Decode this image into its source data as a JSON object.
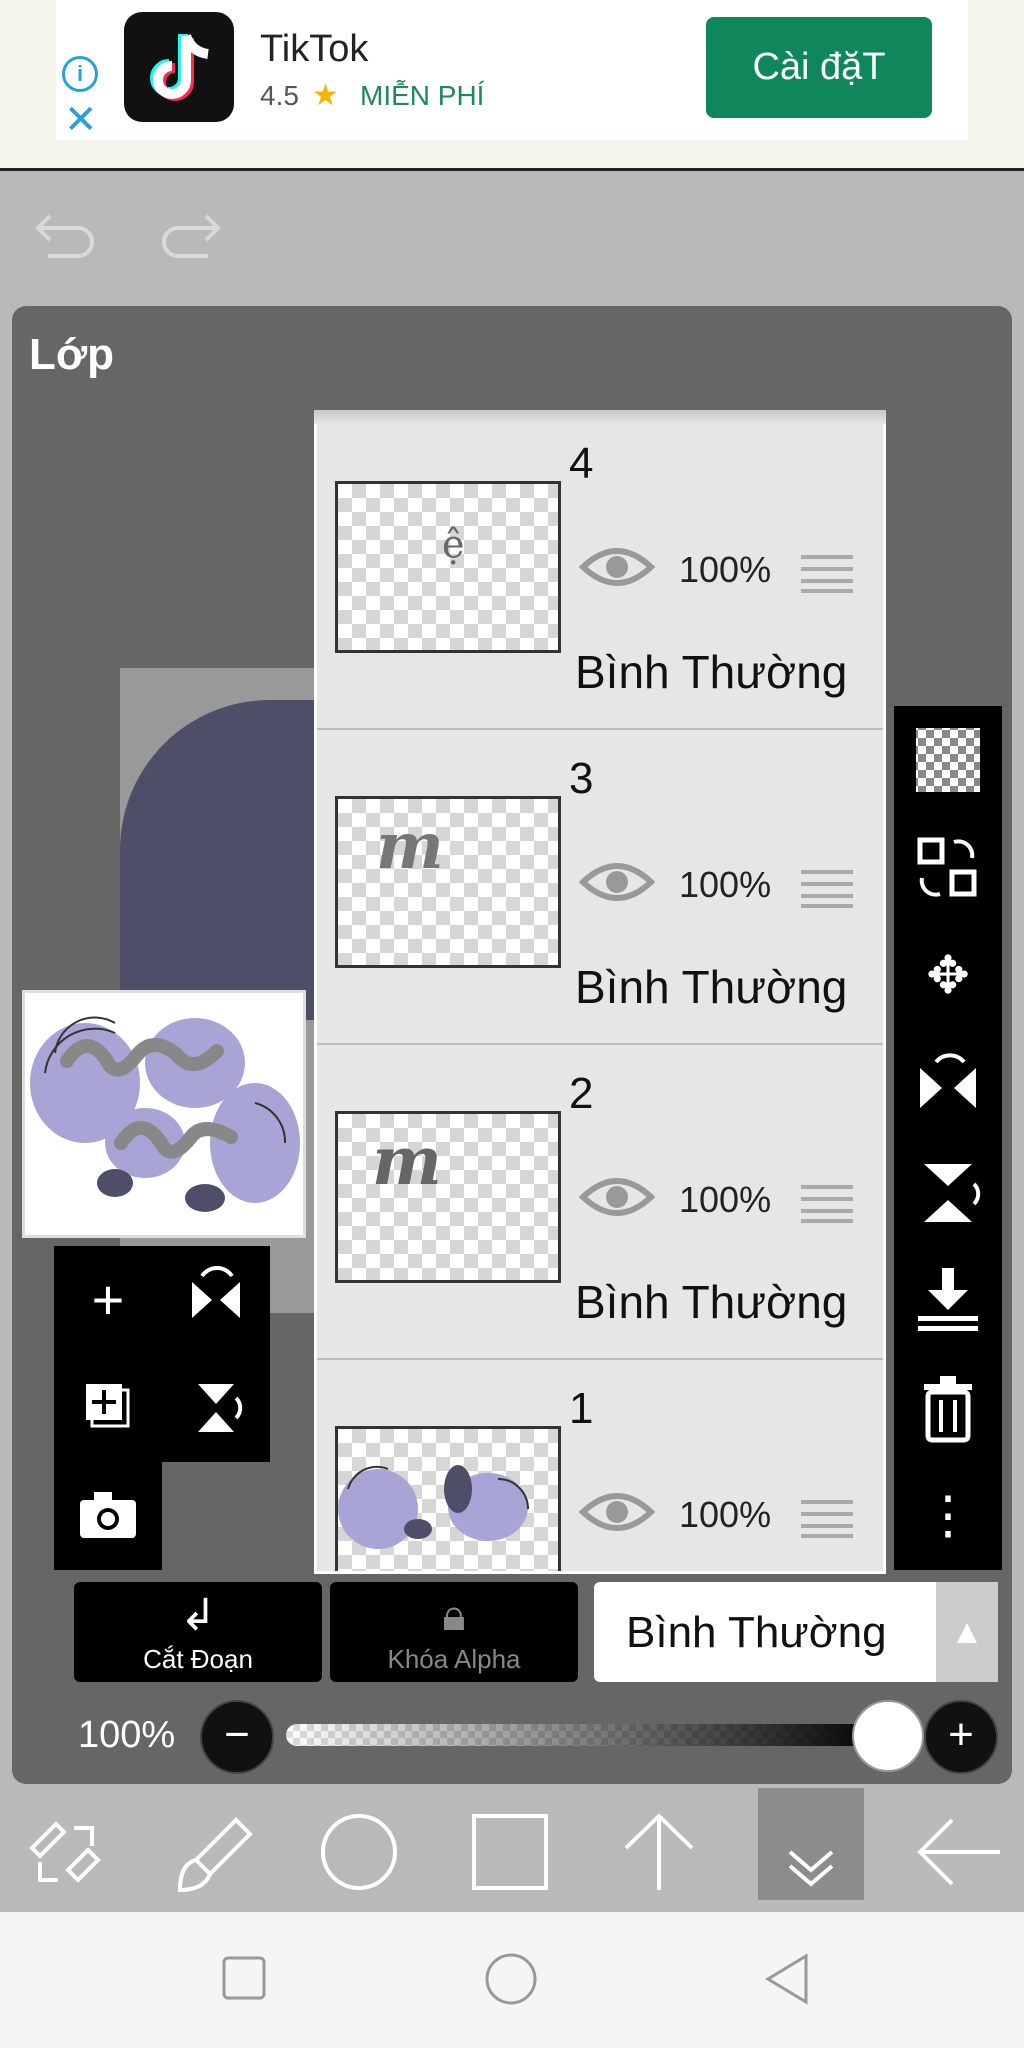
{
  "ad": {
    "app_name": "TikTok",
    "rating": "4.5",
    "price": "MIỄN PHÍ",
    "install_label": "Cài đặT",
    "info_icon": "info-icon",
    "close_icon": "close-icon"
  },
  "toolbar_top": {
    "undo_icon": "undo-icon",
    "redo_icon": "redo-icon"
  },
  "panel": {
    "title": "Lớp"
  },
  "layers": [
    {
      "number": "4",
      "opacity": "100%",
      "blend_mode": "Bình Thường",
      "glyph": "ệ"
    },
    {
      "number": "3",
      "opacity": "100%",
      "blend_mode": "Bình Thường",
      "glyph": "m"
    },
    {
      "number": "2",
      "opacity": "100%",
      "blend_mode": "Bình Thường",
      "glyph": "m"
    },
    {
      "number": "1",
      "opacity": "100%",
      "blend_mode": "Bình Thường",
      "glyph": ""
    }
  ],
  "controls": {
    "clip_label": "Cắt Đoạn",
    "alpha_lock_label": "Khóa Alpha",
    "blend_mode": "Bình Thường",
    "opacity_label": "100%",
    "opacity_value": 1.0
  },
  "colors": {
    "accent_green": "#0f875b",
    "panel_bg": "#666666",
    "layer_bg": "#e6e6e6",
    "art_purple": "#9b98c9"
  }
}
